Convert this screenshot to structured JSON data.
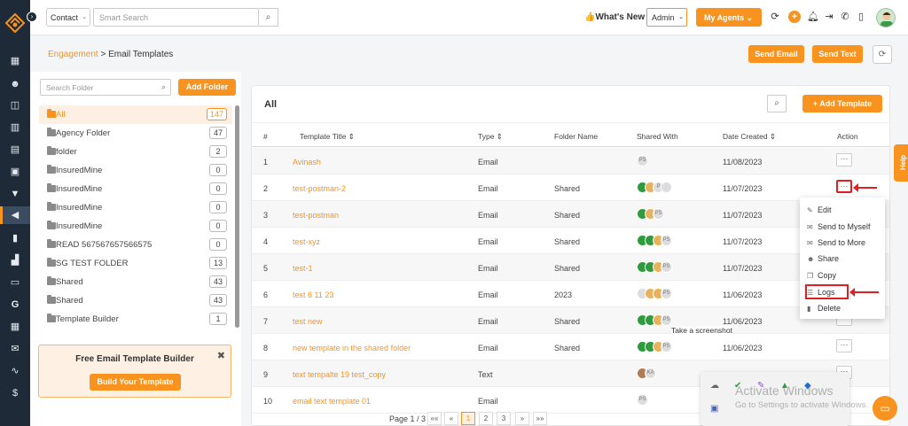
{
  "topbar": {
    "contact_select": "Contact",
    "search_placeholder": "Smart Search",
    "whats_new": "What's New",
    "role_select": "Admin",
    "my_agents": "My Agents"
  },
  "header": {
    "breadcrumb_link": "Engagement",
    "breadcrumb_sep": " > ",
    "breadcrumb_current": "Email Templates",
    "send_email": "Send Email",
    "send_text": "Send Text"
  },
  "folders": {
    "search_placeholder": "Search Folder",
    "add_folder": "Add Folder",
    "items": [
      {
        "name": "All",
        "count": "147"
      },
      {
        "name": "Agency Folder",
        "count": "47"
      },
      {
        "name": "folder",
        "count": "2"
      },
      {
        "name": "InsuredMine",
        "count": "0"
      },
      {
        "name": "InsuredMine",
        "count": "0"
      },
      {
        "name": "InsuredMine",
        "count": "0"
      },
      {
        "name": "InsuredMine",
        "count": "0"
      },
      {
        "name": "READ 567567657566575",
        "count": "0"
      },
      {
        "name": "SG TEST FOLDER",
        "count": "13"
      },
      {
        "name": "Shared",
        "count": "43"
      },
      {
        "name": "Shared",
        "count": "43"
      },
      {
        "name": "Template Builder",
        "count": "1"
      }
    ],
    "promo_title": "Free Email Template Builder",
    "promo_button": "Build Your Template",
    "promo_close": "✖"
  },
  "main": {
    "title": "All",
    "add_template": "+ Add Template",
    "columns": [
      "#",
      "Template Title ⇕",
      "Type ⇕",
      "Folder Name",
      "Shared With",
      "Date Created ⇕",
      "Action"
    ],
    "rows": [
      {
        "num": "1",
        "title": "Avinash",
        "type": "Email",
        "folder": "",
        "date": "11/08/2023"
      },
      {
        "num": "2",
        "title": "test-postman-2",
        "type": "Email",
        "folder": "Shared",
        "date": "11/07/2023"
      },
      {
        "num": "3",
        "title": "test-postman",
        "type": "Email",
        "folder": "Shared",
        "date": "11/07/2023"
      },
      {
        "num": "4",
        "title": "test-xyz",
        "type": "Email",
        "folder": "Shared",
        "date": "11/07/2023"
      },
      {
        "num": "5",
        "title": "test-1",
        "type": "Email",
        "folder": "Shared",
        "date": "11/07/2023"
      },
      {
        "num": "6",
        "title": "test 6 11 23",
        "type": "Email",
        "folder": "2023",
        "date": "11/06/2023"
      },
      {
        "num": "7",
        "title": "test new",
        "type": "Email",
        "folder": "Shared",
        "date": "11/06/2023"
      },
      {
        "num": "8",
        "title": "new template in the shared folder",
        "type": "Email",
        "folder": "Shared",
        "date": "11/06/2023"
      },
      {
        "num": "9",
        "title": "text tempalte 19 test_copy",
        "type": "Text",
        "folder": "",
        "date": ""
      },
      {
        "num": "10",
        "title": "email text template 01",
        "type": "Email",
        "folder": "",
        "date": ""
      }
    ],
    "action_label": "···"
  },
  "action_menu": {
    "items": [
      "Edit",
      "Send to Myself",
      "Send to More",
      "Share",
      "Copy",
      "Logs",
      "Delete"
    ]
  },
  "tooltip": "Take a screenshot",
  "pagination": {
    "label": "Page 1 / 3",
    "first": "««",
    "prev": "«",
    "pages": [
      "1",
      "2",
      "3"
    ],
    "next": "»",
    "last": "»»"
  },
  "help_tab": "Help",
  "watermark": {
    "line1": "Activate Windows",
    "line2": "Go to Settings to activate Windows."
  },
  "colors": {
    "accent": "#f7931e",
    "sidebar": "#1f2a38",
    "annotation_red": "#e02020"
  }
}
